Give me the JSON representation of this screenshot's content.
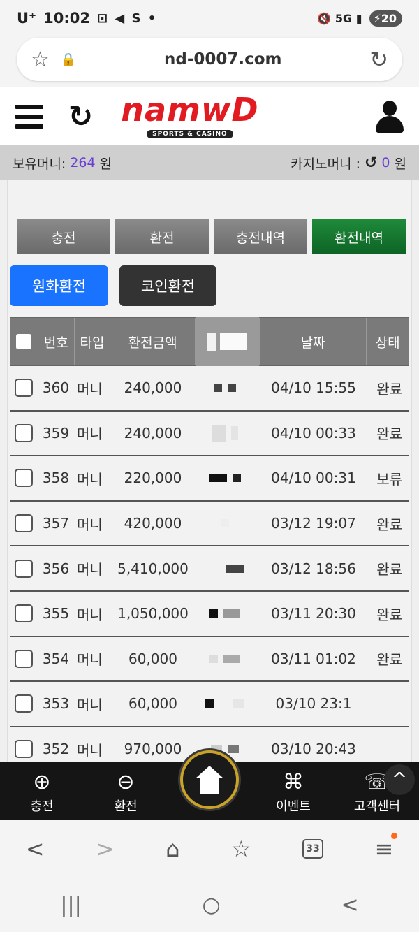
{
  "status_bar": {
    "carrier": "U⁺",
    "time": "10:02",
    "left_icons": "⊡ ◀ S •",
    "right_icons": "🔇 5G ▮",
    "battery": "20"
  },
  "browser": {
    "url": "nd-0007.com",
    "tab_count": "33"
  },
  "site": {
    "logo_text": "namwD",
    "logo_sub": "SPORTS & CASINO",
    "accent_color": "#e21b22"
  },
  "money": {
    "balance_label": "보유머니:",
    "balance_value": "264",
    "balance_unit": "원",
    "casino_label": "카지노머니 :",
    "casino_value": "0",
    "casino_unit": "원"
  },
  "tabs": [
    {
      "label": "충전"
    },
    {
      "label": "환전"
    },
    {
      "label": "충전내역"
    },
    {
      "label": "환전내역"
    }
  ],
  "subtabs": [
    {
      "label": "원화환전"
    },
    {
      "label": "코인환전"
    }
  ],
  "table": {
    "headers": {
      "no": "번호",
      "type": "타입",
      "amount": "환전금액",
      "date": "날짜",
      "status": "상태"
    },
    "rows": [
      {
        "no": "360",
        "type": "머니",
        "amount": "240,000",
        "date": "04/10 15:55",
        "status": "완료"
      },
      {
        "no": "359",
        "type": "머니",
        "amount": "240,000",
        "date": "04/10 00:33",
        "status": "완료"
      },
      {
        "no": "358",
        "type": "머니",
        "amount": "220,000",
        "date": "04/10 00:31",
        "status": "보류"
      },
      {
        "no": "357",
        "type": "머니",
        "amount": "420,000",
        "date": "03/12 19:07",
        "status": "완료"
      },
      {
        "no": "356",
        "type": "머니",
        "amount": "5,410,000",
        "date": "03/12 18:56",
        "status": "완료"
      },
      {
        "no": "355",
        "type": "머니",
        "amount": "1,050,000",
        "date": "03/11 20:30",
        "status": "완료"
      },
      {
        "no": "354",
        "type": "머니",
        "amount": "60,000",
        "date": "03/11 01:02",
        "status": "완료"
      },
      {
        "no": "353",
        "type": "머니",
        "amount": "60,000",
        "date": "03/10 23:1",
        "status": ""
      },
      {
        "no": "352",
        "type": "머니",
        "amount": "970,000",
        "date": "03/10 20:43",
        "status": ""
      }
    ]
  },
  "bottom_nav": [
    {
      "label": "충전",
      "icon": "piggy-plus-icon"
    },
    {
      "label": "환전",
      "icon": "piggy-minus-icon"
    },
    {
      "label": "",
      "icon": "home-icon"
    },
    {
      "label": "이벤트",
      "icon": "gift-icon"
    },
    {
      "label": "고객센터",
      "icon": "support-icon"
    }
  ]
}
